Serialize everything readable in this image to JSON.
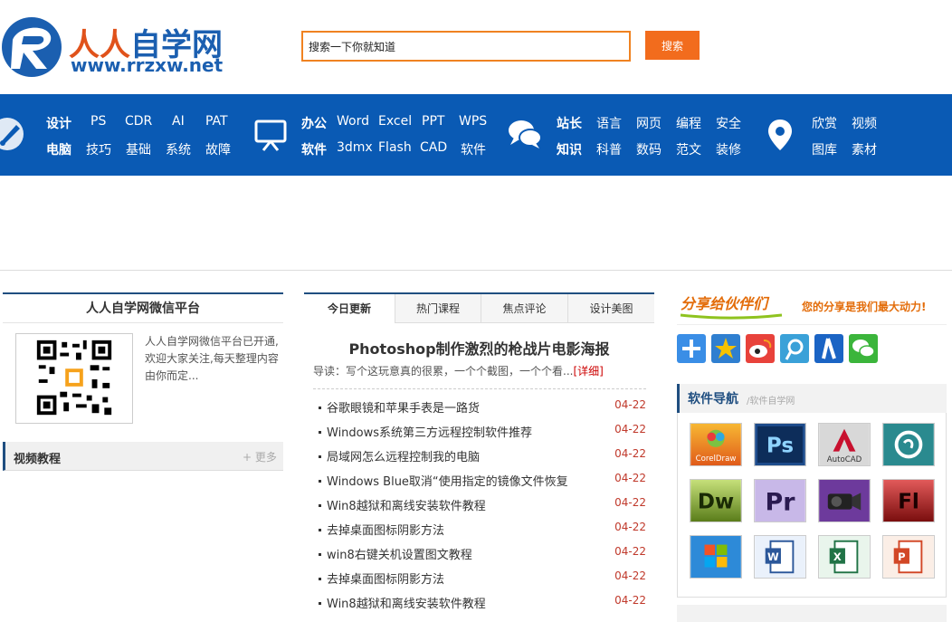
{
  "header": {
    "logo_title_orange": "人人",
    "logo_title_blue": "自学网",
    "logo_url": "www.rrzxw.net",
    "search_value": "搜索一下你就知道",
    "search_button": "搜索",
    "brand_orange": "#e0521b",
    "brand_blue": "#1b5fb0"
  },
  "nav": {
    "bg_color": "#0a5ab4",
    "group1": {
      "icon": "brush-icon",
      "r1": [
        "设计",
        "PS",
        "CDR",
        "AI",
        "PAT"
      ],
      "r2": [
        "电脑",
        "技巧",
        "基础",
        "系统",
        "故障"
      ]
    },
    "group2": {
      "icon": "presentation-icon",
      "r1": [
        "办公",
        "Word",
        "Excel",
        "PPT",
        "WPS"
      ],
      "r2": [
        "软件",
        "3dmx",
        "Flash",
        "CAD",
        "软件"
      ]
    },
    "group3": {
      "icon": "chat-icon",
      "r1": [
        "站长",
        "语言",
        "网页",
        "编程",
        "安全"
      ],
      "r2": [
        "知识",
        "科普",
        "数码",
        "范文",
        "装修"
      ]
    },
    "group4": {
      "icon": "location-pin-icon",
      "r1": [
        "欣赏",
        "视频"
      ],
      "r2": [
        "图库",
        "素材"
      ]
    }
  },
  "wechat": {
    "title": "人人自学网微信平台",
    "desc": "人人自学网微信平台已开通,欢迎大家关注,每天整理内容由你而定..."
  },
  "video": {
    "title": "视频教程",
    "more": "+ 更多"
  },
  "tabs": [
    "今日更新",
    "热门课程",
    "焦点评论",
    "设计美图"
  ],
  "headline": "Photoshop制作激烈的枪战片电影海报",
  "lede": "导读：写个这玩意真的很累，一个个截图，一个个看...",
  "lede_more": "[详细]",
  "news": [
    {
      "title": "谷歌眼镜和苹果手表是一路货",
      "date": "04-22"
    },
    {
      "title": "Windows系统第三方远程控制软件推荐",
      "date": "04-22"
    },
    {
      "title": "局域网怎么远程控制我的电脑",
      "date": "04-22"
    },
    {
      "title": "Windows Blue取消“使用指定的镜像文件恢复",
      "date": "04-22"
    },
    {
      "title": "Win8越狱和离线安装软件教程",
      "date": "04-22"
    },
    {
      "title": "去掉桌面图标阴影方法",
      "date": "04-22"
    },
    {
      "title": "win8右键关机设置图文教程",
      "date": "04-22"
    },
    {
      "title": "去掉桌面图标阴影方法",
      "date": "04-22"
    },
    {
      "title": "Win8越狱和离线安装软件教程",
      "date": "04-22"
    }
  ],
  "share": {
    "banner_left": "分享给伙伴们",
    "banner_right": "您的分享是我们最大动力!",
    "buttons": [
      "plus-share-icon",
      "qzone-icon",
      "weibo-icon",
      "tencent-weibo-icon",
      "renren-icon",
      "wechat-icon"
    ]
  },
  "software": {
    "title": "软件导航",
    "subtitle": "/软件自学网",
    "apps": [
      {
        "name": "CorelDraw",
        "icon": "coreldraw-icon"
      },
      {
        "name": "Ps",
        "icon": "photoshop-icon"
      },
      {
        "name": "AutoCAD",
        "icon": "autocad-icon"
      },
      {
        "name": "",
        "icon": "3dsmax-icon"
      },
      {
        "name": "Dw",
        "icon": "dreamweaver-icon"
      },
      {
        "name": "Pr",
        "icon": "premiere-icon"
      },
      {
        "name": "",
        "icon": "video-camera-icon"
      },
      {
        "name": "Fl",
        "icon": "flash-icon"
      },
      {
        "name": "",
        "icon": "windows-icon"
      },
      {
        "name": "",
        "icon": "word-icon"
      },
      {
        "name": "",
        "icon": "excel-icon"
      },
      {
        "name": "",
        "icon": "powerpoint-icon"
      }
    ]
  }
}
